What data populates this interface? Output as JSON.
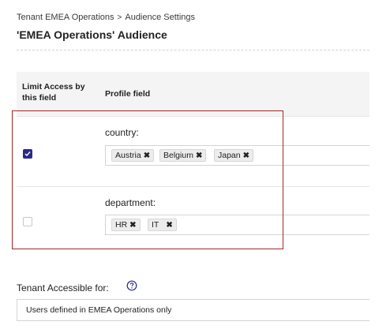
{
  "breadcrumb": {
    "parent": "Tenant EMEA Operations",
    "separator": ">",
    "current": "Audience Settings"
  },
  "page_title": "'EMEA Operations' Audience",
  "table": {
    "headers": {
      "limit_access": "Limit Access by this field",
      "profile_field": "Profile field"
    },
    "rows": [
      {
        "field": "country:",
        "limit_checked": true,
        "tags": [
          "Austria",
          "Belgium",
          "Japan"
        ]
      },
      {
        "field": "department:",
        "limit_checked": false,
        "tags": [
          "HR",
          "IT"
        ]
      }
    ]
  },
  "tag_remove_glyph": "✖",
  "tenant_access": {
    "label": "Tenant Accessible for:",
    "help_icon": "help-circle-icon",
    "selected": "Users defined in EMEA Operations only"
  },
  "colors": {
    "accent": "#2b2a8c",
    "highlight": "#a3262a",
    "header_bg": "#f4f4f4"
  }
}
